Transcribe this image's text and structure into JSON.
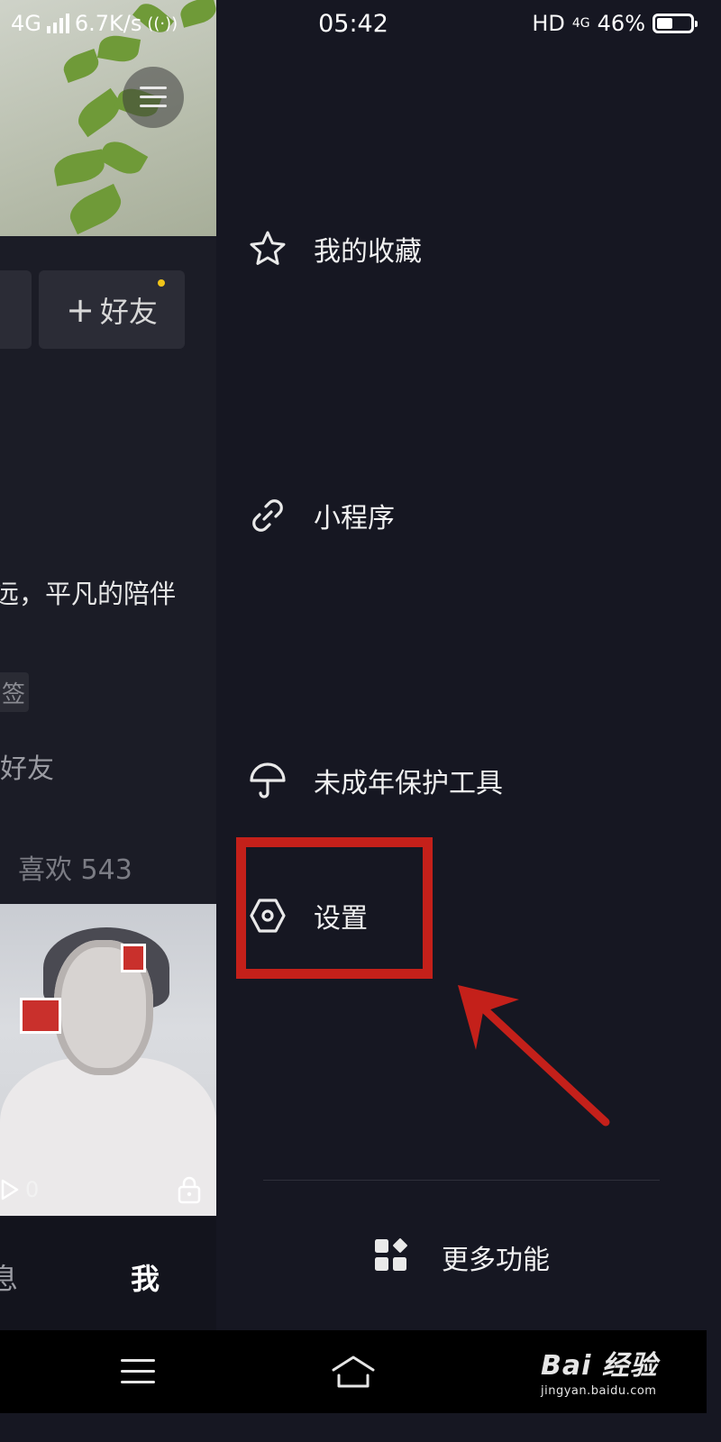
{
  "status_bar": {
    "network": "4G",
    "speed": "6.7K/s",
    "time": "05:42",
    "hd": "HD",
    "network_right": "4G",
    "battery": "46%",
    "battery_level": 0.46
  },
  "profile_background": {
    "add_friend_label": "好友",
    "bio": "远，平凡的陪伴",
    "tag": "签",
    "friends_text": "好友",
    "likes_text": "喜欢 543",
    "video_play_count": "0",
    "tabs": {
      "messages": "息",
      "me": "我"
    }
  },
  "drawer": {
    "items": [
      {
        "label": "我的收藏",
        "icon": "star-icon"
      },
      {
        "label": "小程序",
        "icon": "link-icon"
      },
      {
        "label": "未成年保护工具",
        "icon": "umbrella-icon"
      },
      {
        "label": "设置",
        "icon": "hexagon-settings-icon"
      }
    ],
    "more": {
      "label": "更多功能",
      "icon": "grid-icon"
    }
  },
  "watermark": {
    "main": "Bai 经验",
    "sub": "jingyan.baidu.com"
  },
  "colors": {
    "drawer_bg": "#161722",
    "annotation_red": "#c4201a",
    "notification_dot": "#f0c419"
  }
}
